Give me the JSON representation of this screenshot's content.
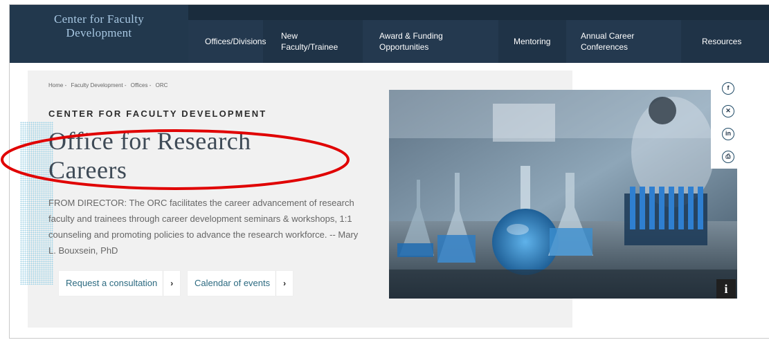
{
  "site": {
    "logo_line1": "Center for Faculty",
    "logo_line2": "Development"
  },
  "nav": {
    "items": [
      {
        "line1": "Offices/Divisions",
        "line2": ""
      },
      {
        "line1": "New",
        "line2": "Faculty/Trainee"
      },
      {
        "line1": "Award & Funding",
        "line2": "Opportunities"
      },
      {
        "line1": "Mentoring",
        "line2": ""
      },
      {
        "line1": "Annual Career",
        "line2": "Conferences"
      },
      {
        "line1": "Resources",
        "line2": ""
      }
    ]
  },
  "breadcrumb": [
    "Home -",
    "Faculty Development -",
    "Offices -",
    "ORC"
  ],
  "hero": {
    "kicker": "CENTER FOR FACULTY DEVELOPMENT",
    "title": "Office for Research Careers",
    "description": "FROM DIRECTOR: The ORC facilitates the career advancement of research faculty and trainees through career development seminars & workshops, 1:1 counseling and promoting policies to advance the research workforce. -- Mary L. Bouxsein, PhD",
    "buttons": [
      {
        "label": "Request a consultation",
        "chevron": "›"
      },
      {
        "label": "Calendar of events",
        "chevron": "›"
      }
    ]
  },
  "social": {
    "facebook": "f",
    "x": "✕",
    "linkedin": "in",
    "print": "⎙"
  },
  "image_info": "i",
  "colors": {
    "nav_bg": "#1f3347",
    "logo_text": "#a8c8e3",
    "hero_bg": "#f1f1f1",
    "link": "#2c6a80",
    "annotation": "#e00000"
  }
}
